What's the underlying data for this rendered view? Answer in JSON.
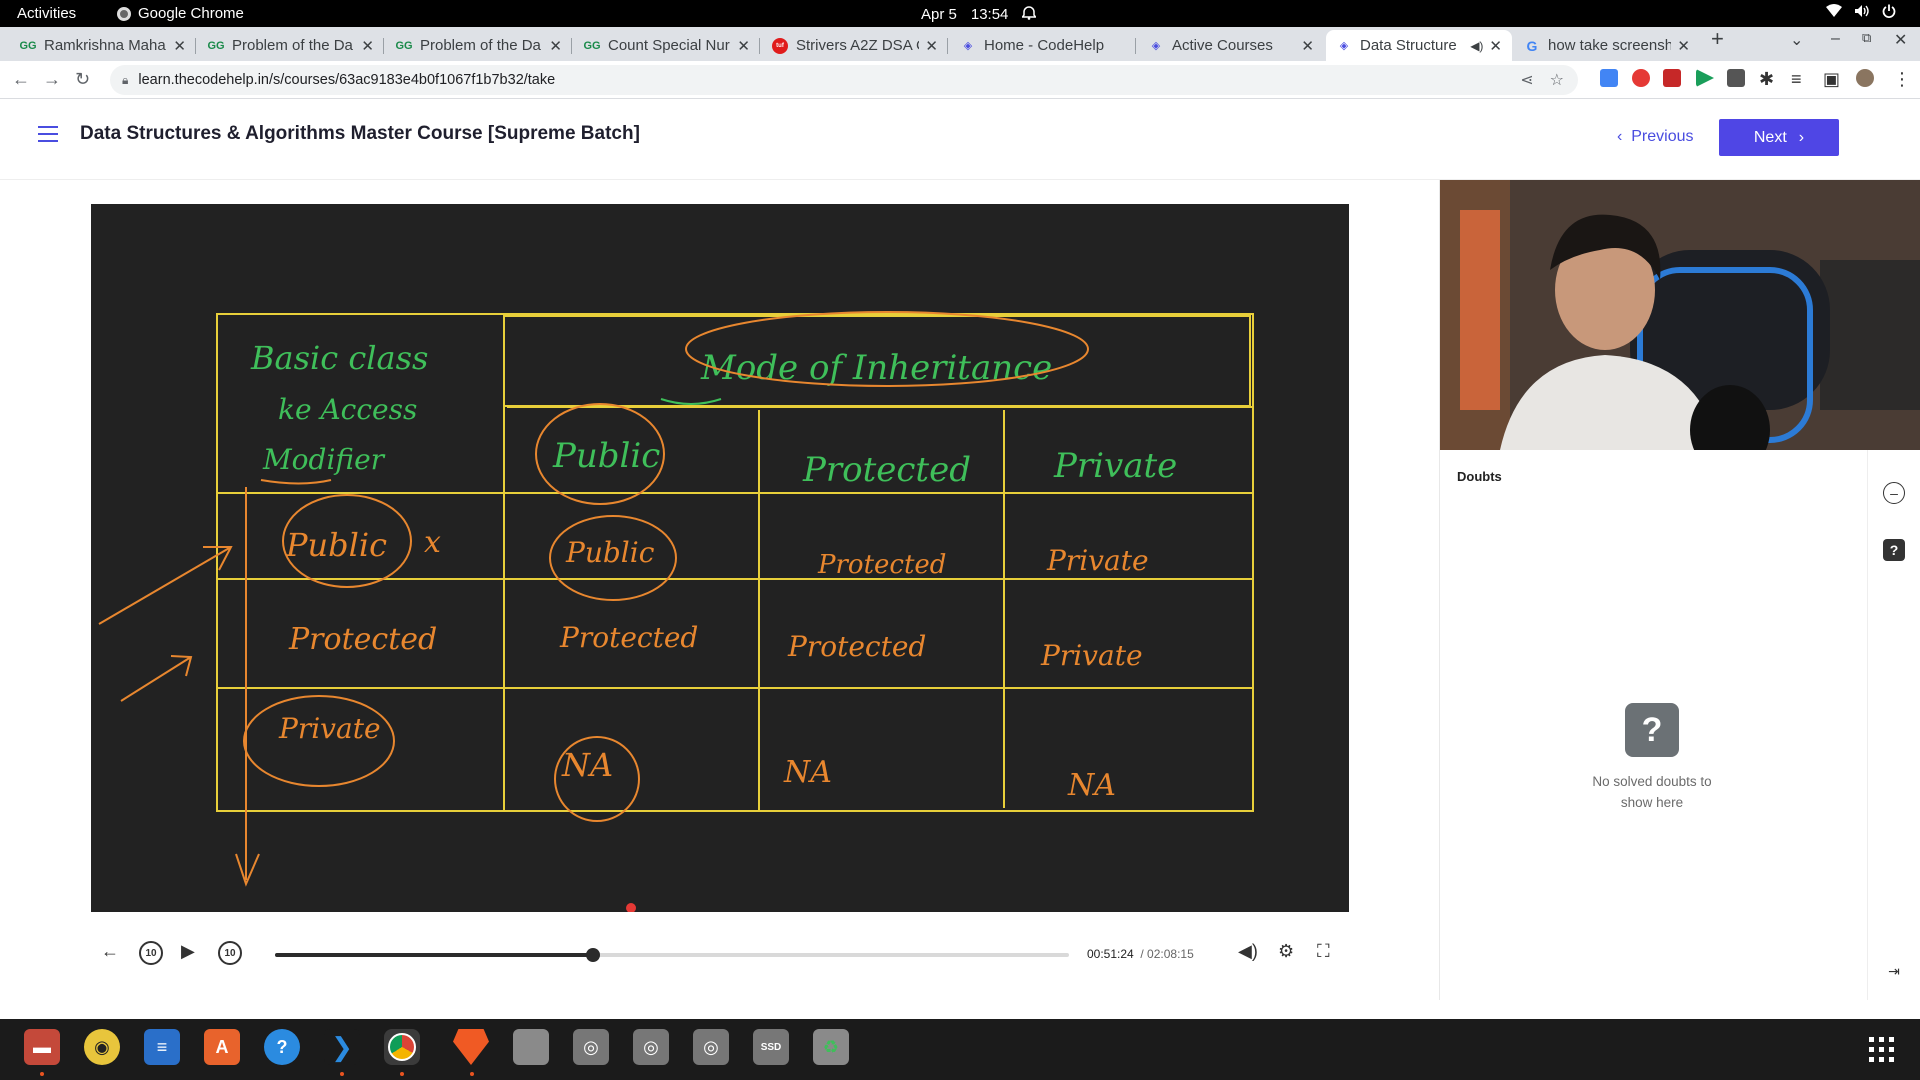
{
  "system": {
    "activities": "Activities",
    "app_name": "Google Chrome",
    "date": "Apr 5",
    "time": "13:54"
  },
  "tabs": [
    {
      "title": "Ramkrishna Maha",
      "favicon": "gfg-icon"
    },
    {
      "title": "Problem of the Da",
      "favicon": "gfg-icon"
    },
    {
      "title": "Problem of the Da",
      "favicon": "gfg-icon"
    },
    {
      "title": "Count Special Nur",
      "favicon": "gfg-icon"
    },
    {
      "title": "Strivers A2Z DSA C",
      "favicon": "tuf-icon"
    },
    {
      "title": "Home - CodeHelp",
      "favicon": "codehelp-icon"
    },
    {
      "title": "Active Courses",
      "favicon": "codehelp-icon"
    },
    {
      "title": "Data Structure",
      "favicon": "codehelp-icon",
      "active": true,
      "audio": true
    },
    {
      "title": "how take screensh",
      "favicon": "google-icon"
    }
  ],
  "address": {
    "url": "learn.thecodehelp.in/s/courses/63ac9183e4b0f1067f1b7b32/take"
  },
  "course": {
    "title": "Data Structures & Algorithms Master Course [Supreme Batch]",
    "prev_label": "Previous",
    "next_label": "Next"
  },
  "player": {
    "current_time": "00:51:24",
    "total_time": "/ 02:08:15",
    "progress_fraction": 0.4,
    "rewind_label": "10",
    "forward_label": "10"
  },
  "whiteboard": {
    "header_left": [
      "Basic class",
      "ke Access",
      "Modifier"
    ],
    "header_mode": "Mode of Inheritance",
    "columns": [
      "Public",
      "Protected",
      "Private"
    ],
    "rows": [
      {
        "base": "Public",
        "cells": [
          "Public",
          "Protected",
          "Private"
        ]
      },
      {
        "base": "Protected",
        "cells": [
          "Protected",
          "Protected",
          "Private"
        ]
      },
      {
        "base": "Private",
        "cells": [
          "NA",
          "NA",
          "NA"
        ]
      }
    ],
    "mark": "x"
  },
  "doubts": {
    "label": "Doubts",
    "empty_message": "No solved doubts to show here",
    "empty_icon": "?"
  },
  "dock": {
    "items": [
      "files-icon",
      "rhythmbox-icon",
      "writer-icon",
      "software-icon",
      "help-icon",
      "vscode-icon",
      "chrome-icon",
      "brave-icon",
      "drive-icon",
      "disk-icon",
      "disk-icon",
      "disk-icon",
      "ssd-icon",
      "trash-icon"
    ],
    "ssd_label": "SSD"
  }
}
